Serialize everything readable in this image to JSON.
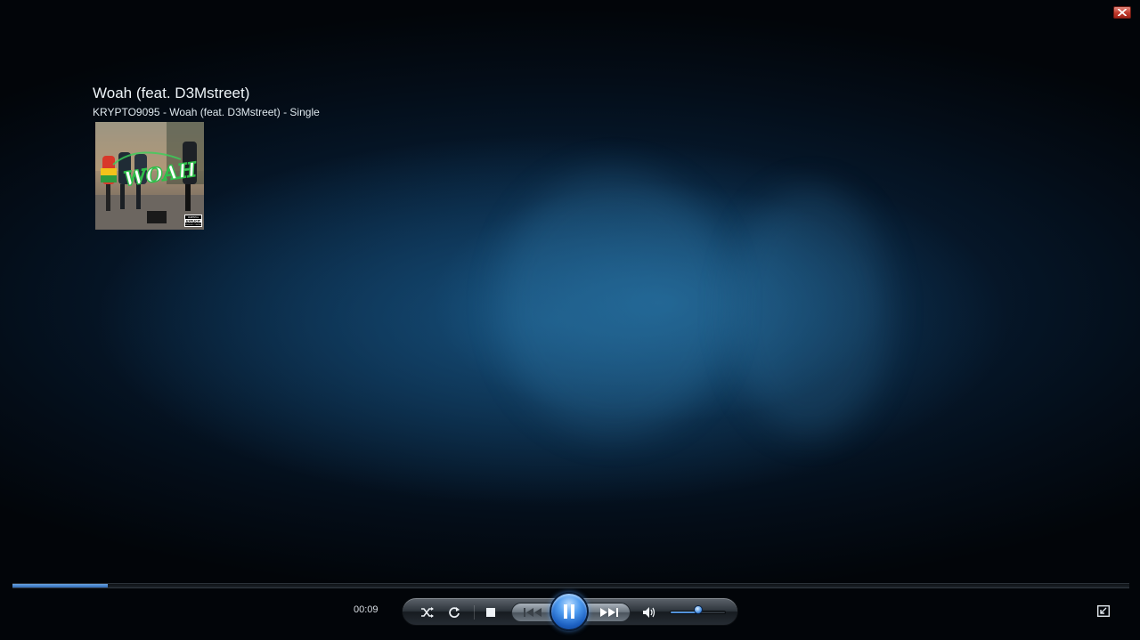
{
  "window": {
    "close_icon": "close-icon",
    "switch_to_library_icon": "switch-to-library-icon"
  },
  "now_playing": {
    "title": "Woah (feat. D3Mstreet)",
    "subtitle": "KRYPTO9095 - Woah (feat. D3Mstreet) - Single",
    "cover_art": {
      "caption": "WOAH",
      "advisory_top": "PARENTAL",
      "advisory_mid": "EXPLICIT",
      "advisory_bottom": "ADVISORY CONTENT"
    }
  },
  "playback": {
    "elapsed": "00:09",
    "progress_fraction": 0.085,
    "volume_fraction": 0.5,
    "state": "playing"
  },
  "controls": {
    "shuffle_icon": "shuffle-icon",
    "repeat_icon": "repeat-icon",
    "stop_icon": "stop-icon",
    "previous_icon": "previous-icon",
    "pause_icon": "pause-icon",
    "next_icon": "next-icon",
    "mute_icon": "speaker-icon"
  },
  "colors": {
    "accent_blue": "#3c7fd6",
    "close_red": "#c0392b"
  }
}
